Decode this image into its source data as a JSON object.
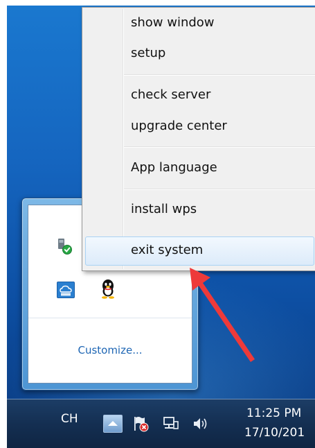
{
  "context_menu": {
    "items": [
      {
        "label": "show window"
      },
      {
        "label": "setup"
      },
      {
        "label": "check server"
      },
      {
        "label": "upgrade center"
      },
      {
        "label": "App language"
      },
      {
        "label": "install wps"
      },
      {
        "label": "exit system"
      }
    ]
  },
  "tray_popup": {
    "customize_label": "Customize..."
  },
  "taskbar": {
    "language": "CH",
    "time": "11:25 PM",
    "date": "17/10/201"
  },
  "colors": {
    "arrow": "#ee3a3a",
    "link": "#1e66b4",
    "hover_border": "#a8d2f4"
  },
  "icons": [
    "usb-check-icon",
    "cloud-app-icon",
    "qq-penguin-icon",
    "show-hidden-icons-icon",
    "action-center-flag-icon",
    "network-icon",
    "volume-icon"
  ]
}
